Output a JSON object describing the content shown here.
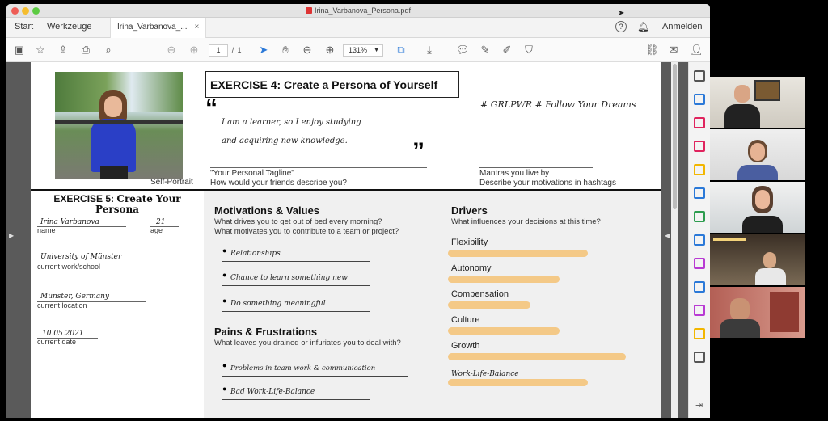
{
  "window": {
    "title": "Irina_Varbanova_Persona.pdf",
    "light_colors": [
      "#ee5d56",
      "#f5bd2e",
      "#5ccb42"
    ]
  },
  "tabs": {
    "start": "Start",
    "tools": "Werkzeuge",
    "document": "Irina_Varbanova_...",
    "close": "×",
    "signin": "Anmelden"
  },
  "toolbar": {
    "page_current": "1",
    "page_sep": "/",
    "page_total": "1",
    "zoom": "131%"
  },
  "pdf": {
    "ex4_title": "EXERCISE 4: Create a Persona of Yourself",
    "quote_open": "“",
    "quote_close": "”",
    "tagline_hand_1": "I am a learner, so I enjoy studying",
    "tagline_hand_2": "and acquiring new knowledge.",
    "tagline_label": "\"Your Personal Tagline\"",
    "tagline_sub": "How would your friends describe you?",
    "hashtags": "# GRLPWR   # Follow Your Dreams",
    "mantra_label": "Mantras you live by",
    "mantra_sub": "Describe your motivations in hashtags",
    "self_portrait": "Self-Portrait",
    "ex5_title_a": "EXERCISE 5:",
    "ex5_title_b": "Create Your Persona",
    "name_value": "Irina Varbanova",
    "name_label": "name",
    "age_value": "21",
    "age_label": "age",
    "work_value": "University of Münster",
    "work_label": "current work/school",
    "location_value": "Münster, Germany",
    "location_label": "current location",
    "date_value": "10.05.2021",
    "date_label": "current date",
    "motivations_title": "Motivations & Values",
    "motivations_q1": "What drives you to get out of bed every morning?",
    "motivations_q2": "What motivates you to contribute to a team or project?",
    "motivations_items": [
      "Relationships",
      "Chance to learn something new",
      "Do something meaningful"
    ],
    "pains_title": "Pains & Frustrations",
    "pains_q": "What leaves you drained or infuriates you to deal with?",
    "pains_items": [
      "Problems in team work & communication",
      "Bad Work-Life-Balance"
    ],
    "drivers_title": "Drivers",
    "drivers_q": "What influences your decisions at this time?",
    "drivers": [
      {
        "label": "Flexibility",
        "level": 0.78
      },
      {
        "label": "Autonomy",
        "level": 0.62
      },
      {
        "label": "Compensation",
        "level": 0.46
      },
      {
        "label": "Culture",
        "level": 0.62
      },
      {
        "label": "Growth",
        "level": 0.99
      },
      {
        "label": "Work-Life-Balance",
        "level": 0.78
      }
    ],
    "accent": "#f4c987"
  },
  "sidebar_tools": [
    {
      "name": "search-tool-icon",
      "color": "#555555"
    },
    {
      "name": "export-pdf-icon",
      "color": "#2b79d8"
    },
    {
      "name": "organize-pages-icon",
      "color": "#e0245e"
    },
    {
      "name": "create-pdf-icon",
      "color": "#e0245e"
    },
    {
      "name": "comment-icon",
      "color": "#f2b600"
    },
    {
      "name": "combine-files-icon",
      "color": "#2b79d8"
    },
    {
      "name": "export-excel-icon",
      "color": "#2e9d4f"
    },
    {
      "name": "scan-ocr-icon",
      "color": "#2b79d8"
    },
    {
      "name": "fill-sign-icon",
      "color": "#b83ad3"
    },
    {
      "name": "protect-icon",
      "color": "#2b79d8"
    },
    {
      "name": "edit-pdf-icon",
      "color": "#b83ad3"
    },
    {
      "name": "send-for-review-icon",
      "color": "#f2b600"
    },
    {
      "name": "more-tools-icon",
      "color": "#555555"
    }
  ]
}
